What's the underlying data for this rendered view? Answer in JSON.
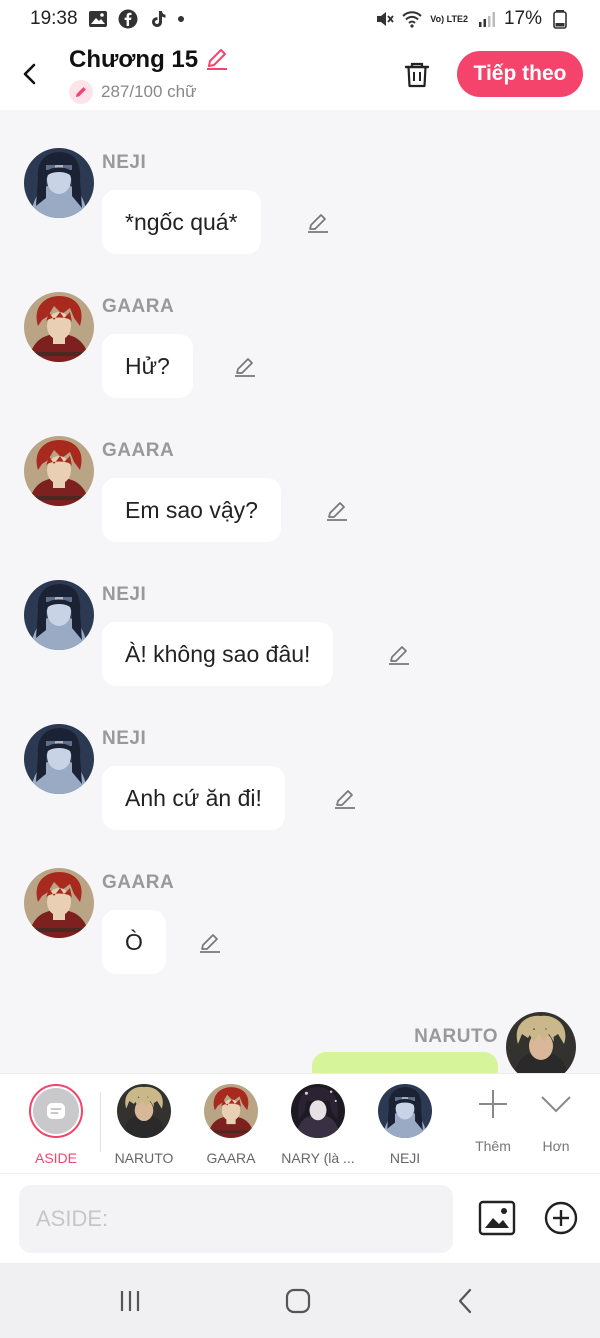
{
  "status_bar": {
    "time": "19:38",
    "battery": "17%",
    "network": "Vo) LTE2"
  },
  "header": {
    "title": "Chương 15",
    "word_count": "287/100 chữ",
    "next_button": "Tiếp theo"
  },
  "messages": [
    {
      "sender": "NEJI",
      "text": "*ngốc quá*",
      "avatar": "neji"
    },
    {
      "sender": "GAARA",
      "text": "Hử?",
      "avatar": "gaara"
    },
    {
      "sender": "GAARA",
      "text": "Em sao vậy?",
      "avatar": "gaara"
    },
    {
      "sender": "NEJI",
      "text": "À! không sao đâu!",
      "avatar": "neji"
    },
    {
      "sender": "NEJI",
      "text": "Anh cứ ăn đi!",
      "avatar": "neji"
    },
    {
      "sender": "GAARA",
      "text": "Ò",
      "avatar": "gaara"
    },
    {
      "sender": "NARUTO",
      "text": "",
      "avatar": "naruto"
    }
  ],
  "characters": [
    {
      "label": "ASIDE",
      "active": true
    },
    {
      "label": "NARUTO",
      "active": false
    },
    {
      "label": "GAARA",
      "active": false
    },
    {
      "label": "NARY (là ...",
      "active": false
    },
    {
      "label": "NEJI",
      "active": false
    }
  ],
  "tools": {
    "add_label": "Thêm",
    "more_label": "Hơn"
  },
  "input": {
    "placeholder": "ASIDE:"
  },
  "colors": {
    "accent": "#f4446b",
    "naruto_bubble": "#d6f59a",
    "background": "#f6f6f8"
  }
}
